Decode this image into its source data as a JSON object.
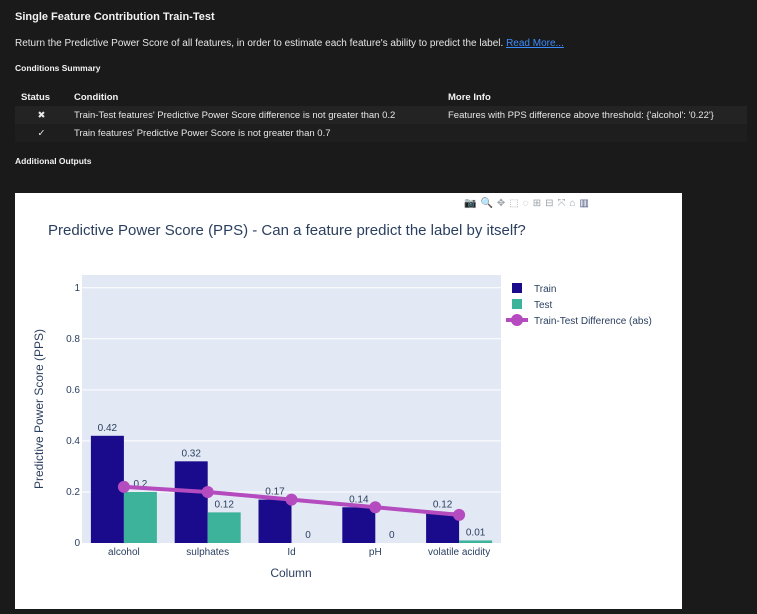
{
  "title": "Single Feature Contribution Train-Test",
  "description": "Return the Predictive Power Score of all features, in order to estimate each feature's ability to predict the label.",
  "read_more": "Read More...",
  "conditions_summary": "Conditions Summary",
  "table": {
    "headers": [
      "Status",
      "Condition",
      "More Info"
    ],
    "rows": [
      {
        "status": "✖",
        "condition": "Train-Test features' Predictive Power Score difference is not greater than 0.2",
        "info": "Features with PPS difference above threshold: {'alcohol': '0.22'}"
      },
      {
        "status": "✓",
        "condition": "Train features' Predictive Power Score is not greater than 0.7",
        "info": ""
      }
    ]
  },
  "additional_outputs": "Additional Outputs",
  "modebar": [
    "camera-icon",
    "zoom-icon",
    "pan-icon",
    "box-select-icon",
    "lasso-icon",
    "zoom-in-icon",
    "zoom-out-icon",
    "autoscale-icon",
    "home-icon",
    "plotly-logo"
  ],
  "chart_data": {
    "type": "bar",
    "title": "Predictive Power Score (PPS) - Can a feature predict the label by itself?",
    "xlabel": "Column",
    "ylabel": "Predictive Power Score (PPS)",
    "ylim": [
      0,
      1.05
    ],
    "yticks": [
      "0",
      "0.2",
      "0.4",
      "0.6",
      "0.8",
      "1"
    ],
    "categories": [
      "alcohol",
      "sulphates",
      "Id",
      "pH",
      "volatile acidity"
    ],
    "series": [
      {
        "name": "Train",
        "type": "bar",
        "color": "#1a0a8c",
        "values": [
          0.42,
          0.32,
          0.17,
          0.14,
          0.12
        ],
        "labels": [
          "0.42",
          "0.32",
          "0.17",
          "0.14",
          "0.12"
        ]
      },
      {
        "name": "Test",
        "type": "bar",
        "color": "#3db39c",
        "values": [
          0.2,
          0.12,
          0,
          0,
          0.01
        ],
        "labels": [
          "0.2",
          "0.12",
          "0",
          "0",
          "0.01"
        ]
      },
      {
        "name": "Train-Test Difference (abs)",
        "type": "line",
        "color": "#b44bbf",
        "values": [
          0.22,
          0.2,
          0.17,
          0.14,
          0.11
        ]
      }
    ],
    "legend": "top-right",
    "grid": true,
    "plot_bg": "#e3e9f4"
  }
}
